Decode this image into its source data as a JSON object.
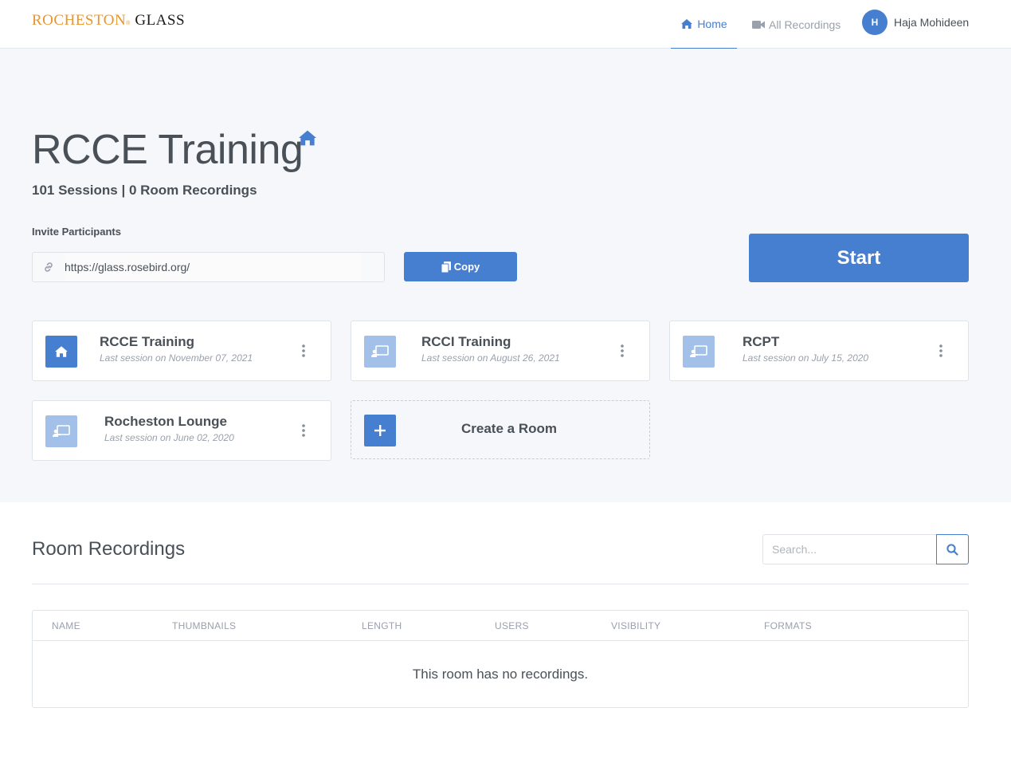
{
  "header": {
    "logo_part1": "ROCHESTON",
    "logo_mark": "®",
    "logo_part2": "GLASS",
    "nav": {
      "home_label": "Home",
      "recordings_label": "All Recordings"
    },
    "user": {
      "initial": "H",
      "name": "Haja Mohideen"
    }
  },
  "room": {
    "title": "RCCE Training",
    "stats": "101 Sessions | 0 Room Recordings",
    "invite_label": "Invite Participants",
    "invite_url": "https://glass.rosebird.org/",
    "copy_label": "Copy",
    "start_label": "Start"
  },
  "rooms": [
    {
      "name": "RCCE Training",
      "last_session": "Last session on November 07, 2021",
      "icon": "home-icon",
      "active": true
    },
    {
      "name": "RCCI Training",
      "last_session": "Last session on August 26, 2021",
      "icon": "presentation-icon",
      "active": false
    },
    {
      "name": "RCPT",
      "last_session": "Last session on July 15, 2020",
      "icon": "presentation-icon",
      "active": false
    },
    {
      "name": "Rocheston Lounge",
      "last_session": "Last session on June 02, 2020",
      "icon": "presentation-icon",
      "active": false
    }
  ],
  "create_room_label": "Create a Room",
  "recordings": {
    "title": "Room Recordings",
    "search_placeholder": "Search...",
    "columns": [
      "NAME",
      "THUMBNAILS",
      "LENGTH",
      "USERS",
      "VISIBILITY",
      "FORMATS"
    ],
    "empty_message": "This room has no recordings."
  },
  "colors": {
    "accent": "#467fcf",
    "accent_muted": "#a3c0e8",
    "hero_bg": "#f5f7fb",
    "logo_orange": "#e8952b"
  }
}
